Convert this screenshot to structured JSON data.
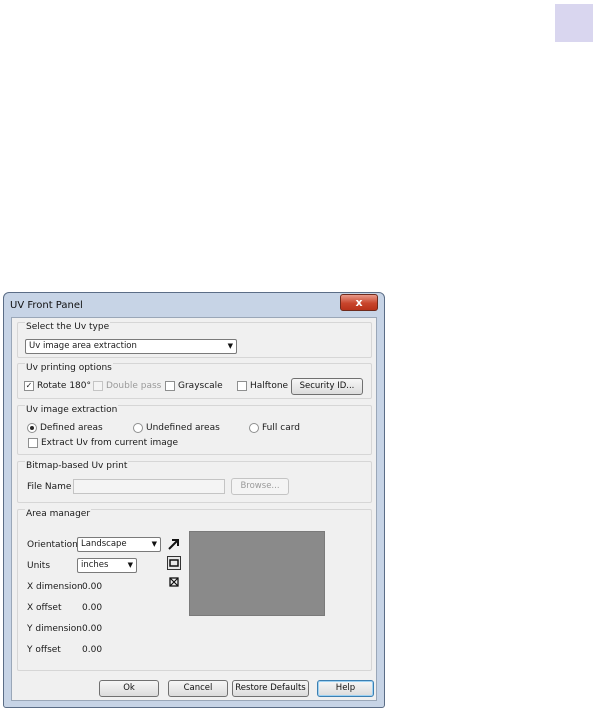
{
  "window": {
    "title": "UV Front Panel",
    "close_glyph": "x"
  },
  "uv_type": {
    "label": "Select the Uv type",
    "selected": "Uv image area extraction"
  },
  "printing_options": {
    "label": "Uv printing options",
    "rotate": {
      "label": "Rotate 180°",
      "checked": true
    },
    "double_pass": {
      "label": "Double pass",
      "checked": false,
      "disabled": true
    },
    "grayscale": {
      "label": "Grayscale",
      "checked": false
    },
    "halftone": {
      "label": "Halftone",
      "checked": false
    },
    "security_button": "Security ID..."
  },
  "image_extraction": {
    "label": "Uv image extraction",
    "radios": [
      {
        "label": "Defined areas",
        "selected": true
      },
      {
        "label": "Undefined areas",
        "selected": false
      },
      {
        "label": "Full card",
        "selected": false
      }
    ],
    "extract_current": {
      "label": "Extract Uv from current image",
      "checked": false
    }
  },
  "bitmap": {
    "label": "Bitmap-based Uv print",
    "file_label": "File Name",
    "file_value": "",
    "browse_button": "Browse..."
  },
  "area_manager": {
    "label": "Area manager",
    "orientation_label": "Orientation",
    "orientation_value": "Landscape",
    "units_label": "Units",
    "units_value": "inches",
    "x_dim_label": "X dimension",
    "x_dim_value": "0.00",
    "x_off_label": "X offset",
    "x_off_value": "0.00",
    "y_dim_label": "Y dimension",
    "y_dim_value": "0.00",
    "y_off_label": "Y offset",
    "y_off_value": "0.00",
    "tools": [
      "arrow-select-icon",
      "draw-rectangle-icon",
      "delete-area-icon"
    ],
    "preview_color": "#8a8a8a"
  },
  "footer": {
    "ok": "Ok",
    "cancel": "Cancel",
    "restore": "Restore Defaults",
    "help": "Help"
  },
  "colors": {
    "frame": "#c7d4e6",
    "client": "#f0f0f0",
    "close": "#c8452c",
    "accent_tab": "#d9d6ef"
  }
}
